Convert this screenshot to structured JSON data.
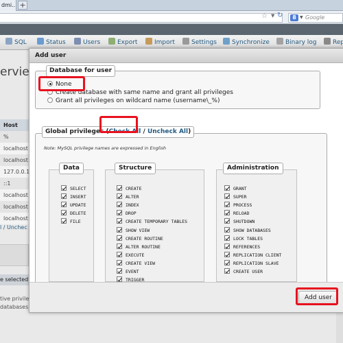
{
  "browser": {
    "tab_title": "dmi...",
    "new_tab_label": "+",
    "search_engine_letter": "8",
    "search_placeholder": "Google"
  },
  "menubar": {
    "items": [
      {
        "label": "SQL"
      },
      {
        "label": "Status"
      },
      {
        "label": "Users"
      },
      {
        "label": "Export"
      },
      {
        "label": "Import"
      },
      {
        "label": "Settings"
      },
      {
        "label": "Synchronize"
      },
      {
        "label": "Binary log"
      },
      {
        "label": "Rep"
      }
    ]
  },
  "background": {
    "overview_fragment": "erview",
    "host_header": "Host",
    "host_rows": [
      "%",
      "localhost",
      "localhost",
      "127.0.0.1",
      "::1",
      "localhost",
      "localhost",
      "localhost"
    ],
    "check_links": "l / Unchec",
    "selected_text": "e selected",
    "note_line1": "tive privileg",
    "note_line2": "databases t"
  },
  "dialog": {
    "title": "Add user",
    "database_section": {
      "legend": "Database for user",
      "options": [
        {
          "label": "None",
          "selected": true
        },
        {
          "label": "Create database with same name and grant all privileges",
          "selected": false
        },
        {
          "label": "Grant all privileges on wildcard name (username\\_%)",
          "selected": false
        }
      ]
    },
    "global_section": {
      "legend_prefix": "Global privileges ",
      "open_paren": "(",
      "check_all": "Check All",
      "separator": " / ",
      "uncheck_all": "Uncheck All",
      "close_paren": ")",
      "note": "Note: MySQL privilege names are expressed in English",
      "groups": {
        "data": {
          "legend": "Data",
          "items": [
            "SELECT",
            "INSERT",
            "UPDATE",
            "DELETE",
            "FILE"
          ]
        },
        "structure": {
          "legend": "Structure",
          "items": [
            "CREATE",
            "ALTER",
            "INDEX",
            "DROP",
            "CREATE TEMPORARY TABLES",
            "SHOW VIEW",
            "CREATE ROUTINE",
            "ALTER ROUTINE",
            "EXECUTE",
            "CREATE VIEW",
            "EVENT",
            "TRIGGER"
          ]
        },
        "administration": {
          "legend": "Administration",
          "items": [
            "GRANT",
            "SUPER",
            "PROCESS",
            "RELOAD",
            "SHUTDOWN",
            "SHOW DATABASES",
            "LOCK TABLES",
            "REFERENCES",
            "REPLICATION CLIENT",
            "REPLICATION SLAVE",
            "CREATE USER"
          ]
        }
      }
    },
    "submit_label": "Add user"
  },
  "colors": {
    "highlight": "#e8101e",
    "link": "#235a81"
  }
}
